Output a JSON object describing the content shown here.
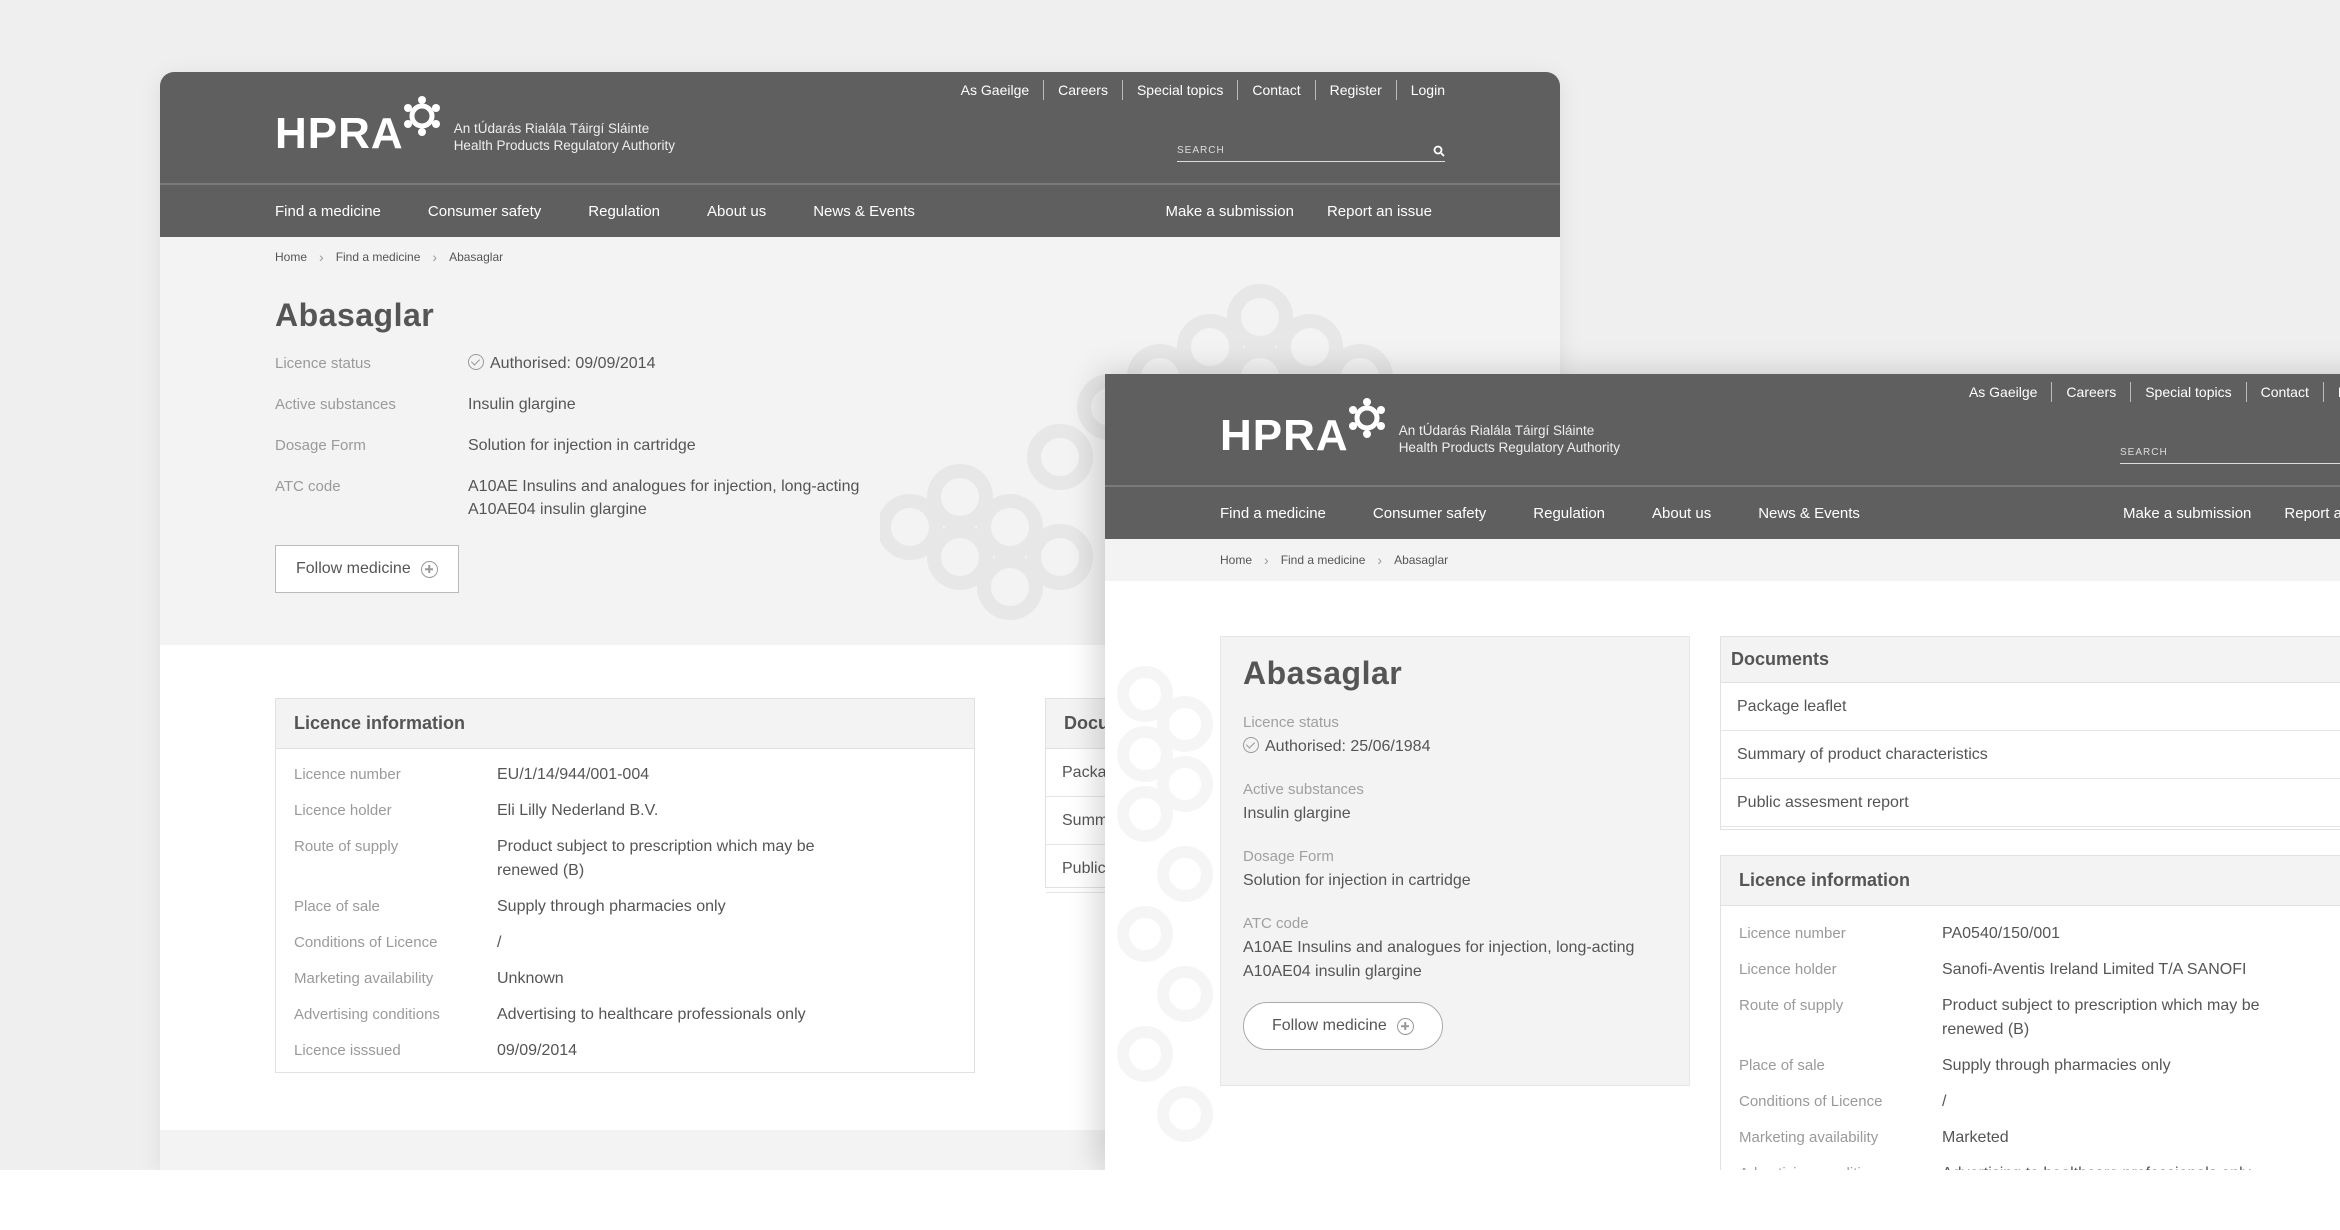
{
  "site": {
    "logo": "HPRA",
    "subtitle_line1": "An tÚdarás Rialála Táirgí Sláinte",
    "subtitle_line2": "Health Products Regulatory Authority",
    "search_placeholder": "SEARCH"
  },
  "window1": {
    "utility": [
      "As Gaeilge",
      "Careers",
      "Special topics",
      "Contact",
      "Register",
      "Login"
    ],
    "nav": [
      "Find a medicine",
      "Consumer safety",
      "Regulation",
      "About us",
      "News & Events"
    ],
    "nav_right": [
      "Make a submission",
      "Report an issue"
    ],
    "breadcrumbs": [
      "Home",
      "Find a medicine",
      "Abasaglar"
    ],
    "title": "Abasaglar",
    "props": [
      {
        "label": "Licence status",
        "value": "Authorised: 09/09/2014"
      },
      {
        "label": "Active substances",
        "value": "Insulin glargine"
      },
      {
        "label": "Dosage Form",
        "value": "Solution for injection in cartridge"
      },
      {
        "label": "ATC code",
        "value": "A10AE Insulins and analogues for injection, long-acting",
        "value2": "A10AE04 insulin glargine"
      }
    ],
    "follow_label": "Follow medicine",
    "licence_panel": {
      "heading": "Licence information",
      "rows": [
        {
          "label": "Licence number",
          "value": "EU/1/14/944/001-004"
        },
        {
          "label": "Licence holder",
          "value": "Eli Lilly Nederland B.V."
        },
        {
          "label": "Route of supply",
          "value": "Product subject to prescription which may be renewed (B)"
        },
        {
          "label": "Place of sale",
          "value": "Supply through pharmacies only"
        },
        {
          "label": "Conditions of Licence",
          "value": "/"
        },
        {
          "label": "Marketing availability",
          "value": "Unknown"
        },
        {
          "label": "Advertising conditions",
          "value": "Advertising to healthcare professionals only"
        },
        {
          "label": "Licence isssued",
          "value": "09/09/2014"
        }
      ]
    },
    "docs_panel": {
      "heading": "Docur",
      "rows": [
        "Packa",
        "Summ",
        "Public"
      ]
    }
  },
  "window2": {
    "utility": [
      "As Gaeilge",
      "Careers",
      "Special topics",
      "Contact",
      "Register"
    ],
    "nav": [
      "Find a medicine",
      "Consumer safety",
      "Regulation",
      "About us",
      "News & Events"
    ],
    "nav_right": [
      "Make a submission",
      "Report an"
    ],
    "breadcrumbs": [
      "Home",
      "Find a medicine",
      "Abasaglar"
    ],
    "title": "Abasaglar",
    "card": [
      {
        "label": "Licence status",
        "value": "Authorised: 25/06/1984"
      },
      {
        "label": "Active substances",
        "value": "Insulin glargine"
      },
      {
        "label": "Dosage Form",
        "value": "Solution for injection in cartridge"
      },
      {
        "label": "ATC code",
        "value": "A10AE Insulins and analogues for injection, long-acting",
        "value2": "A10AE04 insulin glargine"
      }
    ],
    "follow_label": "Follow medicine",
    "documents": {
      "heading": "Documents",
      "rows": [
        "Package leaflet",
        "Summary of product characteristics",
        "Public assesment report"
      ]
    },
    "licence_panel": {
      "heading": "Licence information",
      "rows": [
        {
          "label": "Licence number",
          "value": "PA0540/150/001"
        },
        {
          "label": "Licence holder",
          "value": "Sanofi-Aventis Ireland Limited T/A SANOFI"
        },
        {
          "label": "Route of supply",
          "value": "Product subject to prescription which may be renewed (B)"
        },
        {
          "label": "Place of sale",
          "value": "Supply through pharmacies only"
        },
        {
          "label": "Conditions of Licence",
          "value": "/"
        },
        {
          "label": "Marketing availability",
          "value": "Marketed"
        },
        {
          "label": "Advertising conditions",
          "value": "Advertising to healthcare professionals only"
        }
      ]
    }
  }
}
